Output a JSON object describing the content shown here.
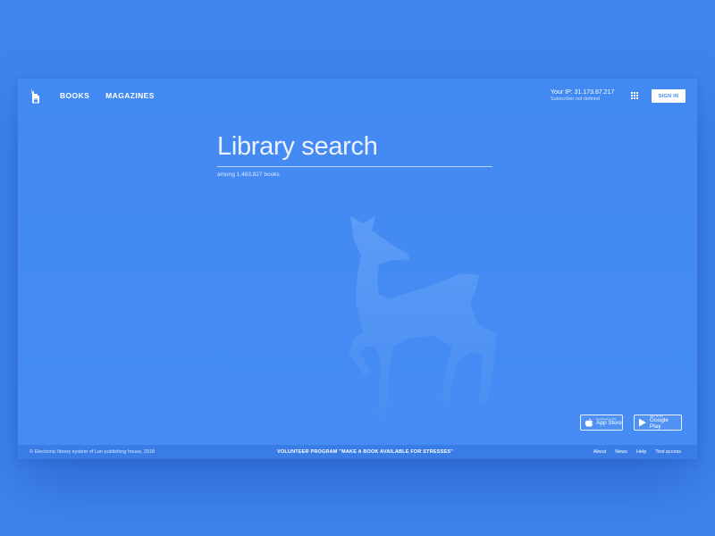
{
  "header": {
    "logo_icon": "deer-logo-icon",
    "nav": [
      "BOOKS",
      "MAGAZINES"
    ],
    "ip_text": "Your IP: 31.173.87.217",
    "subscriber_text": "Subscriber not defined",
    "apps_icon": "apps-grid-icon",
    "signin_label": "SIGN IN"
  },
  "search": {
    "placeholder": "Library search",
    "count_text": "among 1,483,827 books"
  },
  "stores": {
    "appstore_small": "Download on the",
    "appstore_big": "App Store",
    "appstore_icon": "apple-icon",
    "gplay_small": "GET IT ON",
    "gplay_big": "Google Play",
    "gplay_icon": "play-icon"
  },
  "footer": {
    "copyright": "© Electronic library system of Lan publishing house, 2018",
    "volunteer": "VOLUNTEER PROGRAM \"MAKE A BOOK AVAILABLE FOR STRESSES\"",
    "links": [
      "About",
      "News",
      "Help",
      "Test access"
    ]
  },
  "colors": {
    "background": "#3f84ee",
    "card": "#4389f2",
    "footer": "#3a7ce6",
    "signin_text": "#3f84ee"
  }
}
